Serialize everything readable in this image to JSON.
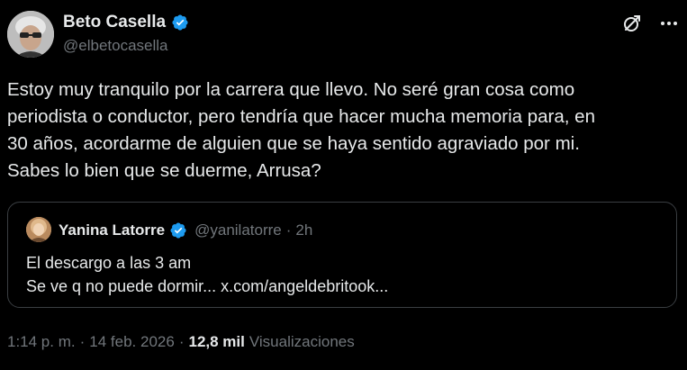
{
  "author": {
    "display_name": "Beto Casella",
    "handle": "@elbetocasella",
    "verified_color": "#1d9bf0"
  },
  "header_actions": {
    "grok_icon": "grok-icon",
    "more_icon": "more-dots-icon"
  },
  "tweet": {
    "text": "Estoy muy tranquilo por la carrera que llevo. No seré gran cosa como\nperiodista o conductor, pero tendría que hacer mucha memoria para, en\n30 años, acordarme de alguien que se haya sentido agraviado por mi.\nSabes lo bien que se duerme, Arrusa?"
  },
  "quote": {
    "display_name": "Yanina Latorre",
    "handle": "@yanilatorre",
    "separator": "·",
    "time": "2h",
    "line1": "El descargo a las 3 am",
    "line2": "Se ve q no puede dormir... x.com/angeldebritook..."
  },
  "meta": {
    "time": "1:14 p. m.",
    "separator1": "·",
    "date": "14 feb. 2026",
    "separator2": "·",
    "views_count": "12,8 mil",
    "views_label": "Visualizaciones"
  },
  "colors": {
    "background": "#000000",
    "text_primary": "#e7e9ea",
    "text_secondary": "#71767b",
    "border": "#3a3e42",
    "accent": "#1d9bf0"
  }
}
